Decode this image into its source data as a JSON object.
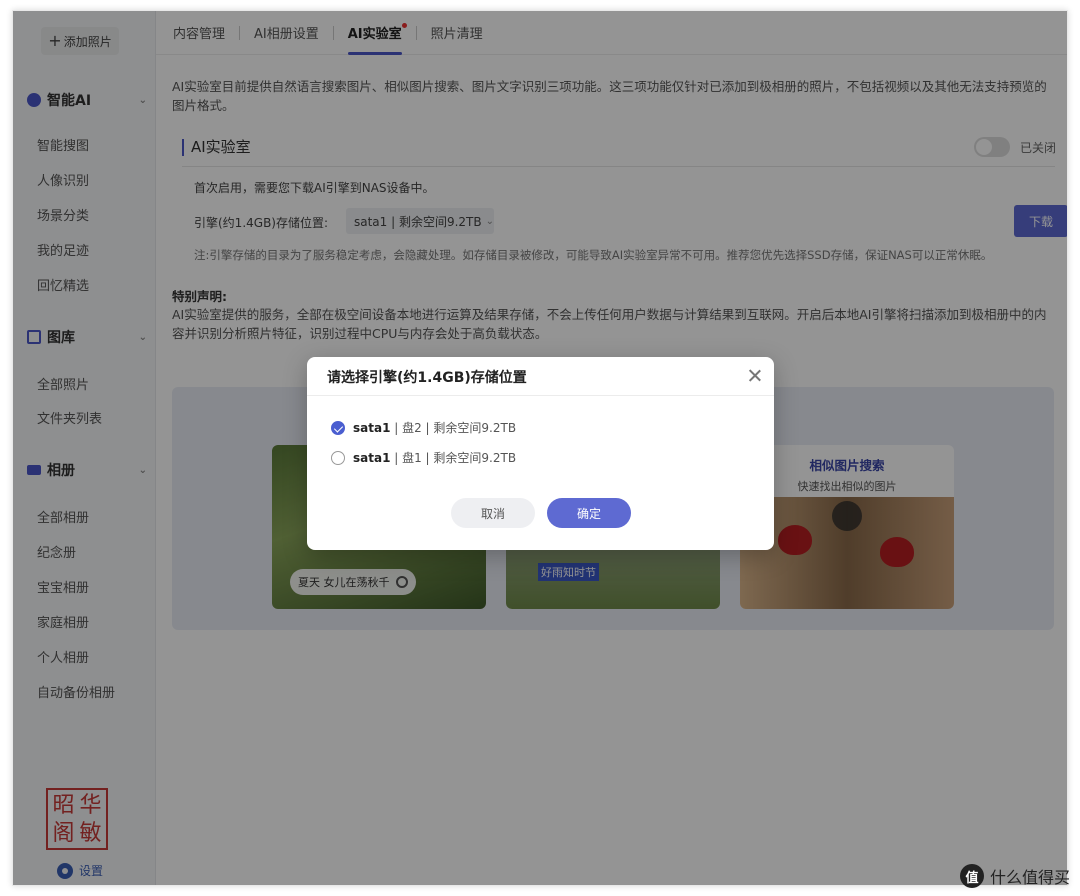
{
  "sidebar": {
    "add_photo": "添加照片",
    "sections": [
      {
        "title": "智能AI",
        "items": [
          "智能搜图",
          "人像识别",
          "场景分类",
          "我的足迹",
          "回忆精选"
        ]
      },
      {
        "title": "图库",
        "items": [
          "全部照片",
          "文件夹列表"
        ]
      },
      {
        "title": "相册",
        "items": [
          "全部相册",
          "纪念册",
          "宝宝相册",
          "家庭相册",
          "个人相册",
          "自动备份相册"
        ]
      }
    ],
    "settings": "设置",
    "seal_text": [
      "昭",
      "华",
      "阁",
      "敏"
    ]
  },
  "tabs": [
    "内容管理",
    "AI相册设置",
    "AI实验室",
    "照片清理"
  ],
  "intro": "AI实验室目前提供自然语言搜索图片、相似图片搜索、图片文字识别三项功能。这三项功能仅针对已添加到极相册的照片，不包括视频以及其他无法支持预览的图片格式。",
  "lab": {
    "title": "AI实验室",
    "toggle_state": "已关闭",
    "first_use": "首次启用，需要您下载AI引擎到NAS设备中。",
    "engine_label": "引擎(约1.4GB)存储位置:",
    "engine_value": "sata1 | 剩余空间9.2TB",
    "download": "下载",
    "note": "注:引擎存储的目录为了服务稳定考虑，会隐藏处理。如存储目录被修改，可能导致AI实验室异常不可用。推荐您优先选择SSD存储，保证NAS可以正常休眠。"
  },
  "declaration": {
    "title": "特别声明:",
    "body": "AI实验室提供的服务，全部在极空间设备本地进行运算及结果存储，不会上传任何用户数据与计算结果到互联网。开启后本地AI引擎将扫描添加到极相册中的内容并识别分析照片特征，识别过程中CPU与内存会处于高负载状态。"
  },
  "cards": {
    "card1_search": "夏天 女儿在荡秋千",
    "card2_tag": "好雨知时节",
    "card3_title": "相似图片搜索",
    "card3_sub": "快速找出相似的图片"
  },
  "modal": {
    "title": "请选择引擎(约1.4GB)存储位置",
    "options": [
      {
        "disk": "sata1",
        "detail": " | 盘2 | 剩余空间9.2TB",
        "selected": true
      },
      {
        "disk": "sata1",
        "detail": " | 盘1 | 剩余空间9.2TB",
        "selected": false
      }
    ],
    "cancel": "取消",
    "confirm": "确定"
  },
  "watermark": {
    "logo": "值",
    "text": "什么值得买"
  }
}
